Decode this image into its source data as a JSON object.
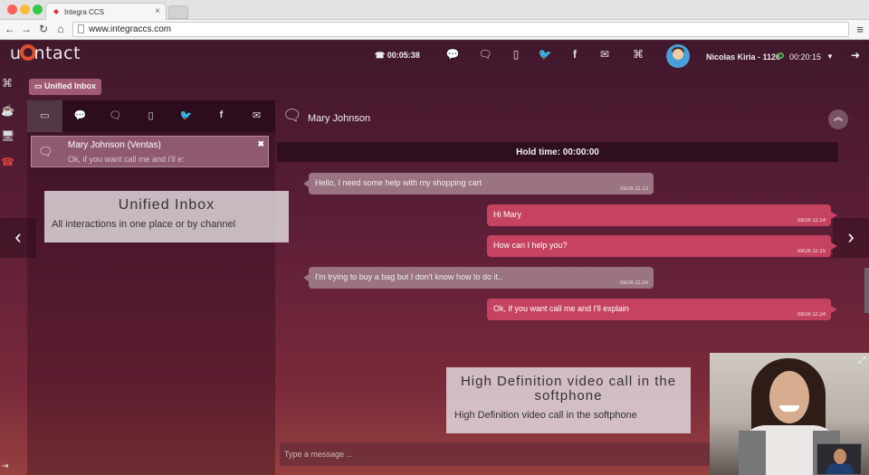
{
  "browser": {
    "tab_title": "Integra CCS",
    "tab_close": "×",
    "url": "www.integraccs.com",
    "nav_icons": [
      "back-icon",
      "forward-icon",
      "reload-icon",
      "home-icon"
    ],
    "menu_icon": "≡"
  },
  "app": {
    "logo_prefix": "u",
    "logo_suffix": "ntact",
    "call_timer": "00:05:38",
    "user_name": "Nicolas Kiria - 1126",
    "connected_time": "00:20:15",
    "header_icons": [
      "chat-icon",
      "chats-icon",
      "mobile-icon",
      "twitter-icon",
      "facebook-icon",
      "email-icon",
      "gamepad-icon"
    ],
    "status_color": "#4caf50"
  },
  "rail": [
    "gamepad-icon",
    "coffee-icon",
    "monitor-icon",
    "phone-icon"
  ],
  "inbox": {
    "badge_label": "Unified Inbox",
    "channels": [
      "inbox-icon",
      "chat-icon",
      "chats-icon",
      "mobile-icon",
      "twitter-icon",
      "facebook-icon",
      "email-icon"
    ],
    "conversation": {
      "name": "Mary Johnson (Ventas)",
      "preview": "Ok, if you want call me and I'll e:"
    }
  },
  "callouts": {
    "inbox_title": "Unified Inbox",
    "inbox_sub": "All interactions in one place or by channel",
    "video_title": "High Definition video call in the softphone",
    "video_sub": "High Definition video call in the softphone"
  },
  "chat": {
    "contact": "Mary Johnson",
    "hold_time": "Hold time: 00:00:00",
    "messages": [
      {
        "dir": "in",
        "text": "Hello, I need some help with my shopping cart",
        "time": "09/26 11:13"
      },
      {
        "dir": "out",
        "text": "Hi Mary",
        "time": "09/26 11:14"
      },
      {
        "dir": "out",
        "text": "How can I help you?",
        "time": "09/26 11:15"
      },
      {
        "dir": "in",
        "text": "I'm trying to buy a bag but I don't know how to do it..",
        "time": "09/26 11:20"
      },
      {
        "dir": "out",
        "text": "Ok, if you want call me and I'll explain",
        "time": "09/26 11:24"
      }
    ],
    "composer_placeholder": "Type a message ..."
  },
  "colors": {
    "accent": "#c54360",
    "incoming": "#9a7482",
    "logo_ring": "#e05030"
  }
}
